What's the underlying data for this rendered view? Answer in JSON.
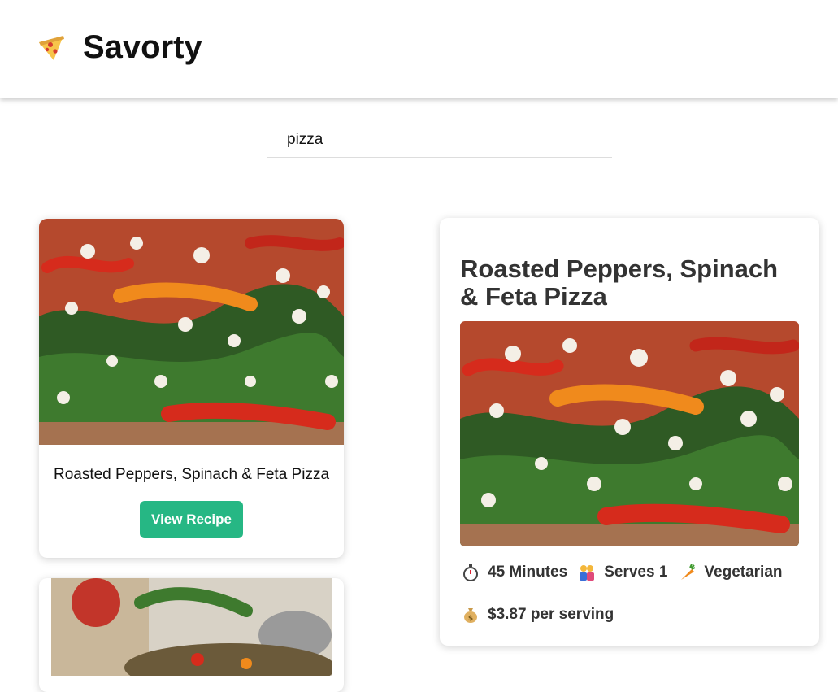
{
  "app": {
    "name": "Savorty",
    "logo_icon": "pizza-slice-icon"
  },
  "search": {
    "value": "pizza"
  },
  "results": [
    {
      "title": "Roasted Peppers, Spinach & Feta Pizza",
      "button_label": "View Recipe"
    },
    {
      "title": ""
    }
  ],
  "detail": {
    "title": "Roasted Peppers, Spinach & Feta Pizza",
    "time": "45 Minutes",
    "serves": "Serves 1",
    "diet": "Vegetarian",
    "price": "$3.87 per serving"
  },
  "colors": {
    "accent": "#26b784",
    "text_dark": "#333333"
  }
}
